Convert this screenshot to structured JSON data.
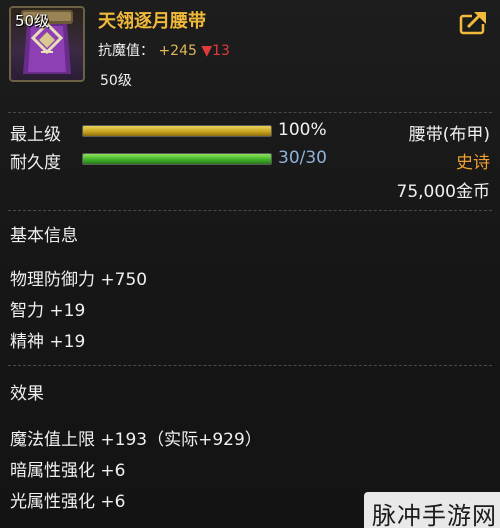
{
  "item": {
    "level_badge": "50级",
    "name": "天翎逐月腰带",
    "resist_label": "抗魔值：",
    "resist_value": "+245",
    "resist_drop": "▼13",
    "required_level": "50级"
  },
  "stats": {
    "max_level": {
      "label": "最上级",
      "value_text": "100%",
      "fill_fraction": 1.0
    },
    "durability": {
      "label": "耐久度",
      "value_text": "30/30",
      "fill_fraction": 1.0
    },
    "type": "腰带(布甲)",
    "rarity": "史诗",
    "price": "75,000金币"
  },
  "basic_info": {
    "title": "基本信息",
    "attributes": [
      "物理防御力 +750",
      "智力 +19",
      "精神 +19"
    ]
  },
  "effects": {
    "title": "效果",
    "lines": [
      "魔法值上限 +193（实际+929）",
      "暗属性强化 +6",
      "光属性强化 +6"
    ]
  },
  "watermark": "脉冲手游网",
  "colors": {
    "item_name": "#f0b93a",
    "rarity": "#f0a030",
    "durability_text": "#8fb2d8",
    "resist_drop": "#e23b3b"
  }
}
